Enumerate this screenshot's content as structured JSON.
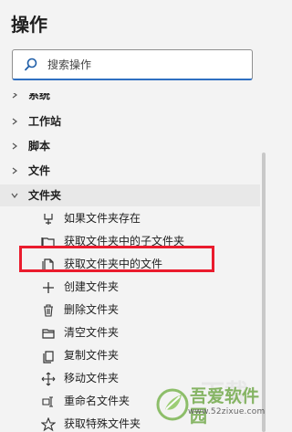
{
  "header": {
    "title": "操作"
  },
  "search": {
    "placeholder": "搜索操作"
  },
  "tree": {
    "partial_top": "系统",
    "categories": [
      {
        "label": "工作站"
      },
      {
        "label": "脚本"
      },
      {
        "label": "文件"
      },
      {
        "label": "文件夹"
      }
    ],
    "actions": [
      {
        "label": "如果文件夹存在",
        "icon": "folder-condition-icon"
      },
      {
        "label": "获取文件夹中的子文件夹",
        "icon": "folders-icon"
      },
      {
        "label": "获取文件夹中的文件",
        "icon": "files-icon"
      },
      {
        "label": "创建文件夹",
        "icon": "plus-icon"
      },
      {
        "label": "删除文件夹",
        "icon": "trash-icon"
      },
      {
        "label": "清空文件夹",
        "icon": "empty-folder-icon"
      },
      {
        "label": "复制文件夹",
        "icon": "copy-icon"
      },
      {
        "label": "移动文件夹",
        "icon": "move-icon"
      },
      {
        "label": "重命名文件夹",
        "icon": "rename-icon"
      },
      {
        "label": "获取特殊文件夹",
        "icon": "star-icon"
      }
    ]
  },
  "watermark": {
    "title": "吾爱软件园",
    "url": "www.52zixue.com",
    "faded_text": "下载"
  },
  "colors": {
    "highlight": "#ea1b2d",
    "search_accent": "#2f6fc1"
  }
}
